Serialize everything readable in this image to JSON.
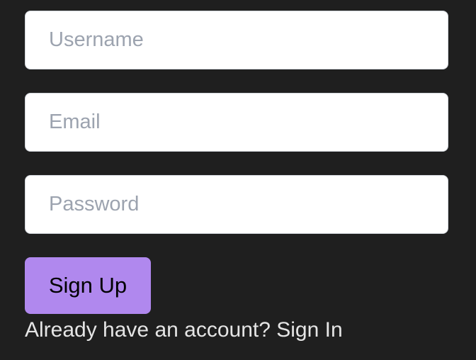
{
  "form": {
    "username": {
      "value": "",
      "placeholder": "Username"
    },
    "email": {
      "value": "",
      "placeholder": "Email"
    },
    "password": {
      "value": "",
      "placeholder": "Password"
    },
    "submit_label": "Sign Up",
    "footer_text": "Already have an account?",
    "signin_link": "Sign In"
  },
  "colors": {
    "background": "#1f1f1f",
    "accent": "#b088ee",
    "placeholder": "#9ca3af"
  }
}
